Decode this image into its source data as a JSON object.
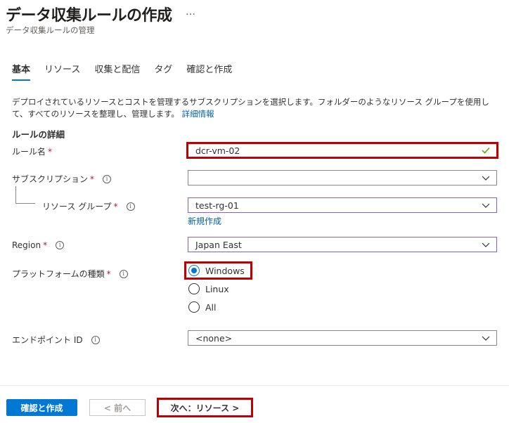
{
  "header": {
    "title": "データ収集ルールの作成",
    "more": "…",
    "subtitle": "データ収集ルールの管理"
  },
  "tabs": [
    {
      "label": "基本",
      "active": true
    },
    {
      "label": "リソース"
    },
    {
      "label": "収集と配信"
    },
    {
      "label": "タグ"
    },
    {
      "label": "確認と作成"
    }
  ],
  "description": {
    "text": "デプロイされているリソースとコストを管理するサブスクリプションを選択します。フォルダーのようなリソース グループを使用して、すべてのリソースを整理し、管理します。",
    "link": "詳細情報"
  },
  "section": {
    "title": "ルールの詳細"
  },
  "form": {
    "rule_name": {
      "label": "ルール名",
      "required": "*",
      "value": "dcr-vm-02"
    },
    "subscription": {
      "label": "サブスクリプション",
      "required": "*",
      "value": ""
    },
    "resource_group": {
      "label": "リソース グループ",
      "required": "*",
      "value": "test-rg-01",
      "new_link": "新規作成"
    },
    "region": {
      "label": "Region",
      "required": "*",
      "value": "Japan East"
    },
    "platform": {
      "label": "プラットフォームの種類",
      "required": "*",
      "options": [
        "Windows",
        "Linux",
        "All"
      ],
      "selected": "Windows"
    },
    "endpoint": {
      "label": "エンドポイント ID",
      "value": "<none>"
    }
  },
  "info_glyph": "i",
  "footer": {
    "review_create": "確認と作成",
    "previous": "< 前へ",
    "next": "次へ：リソース >"
  },
  "colors": {
    "accent": "#0078d4",
    "highlight": "#c00000",
    "link": "#0062ad",
    "focus_border": "#8661c5",
    "valid": "#57a300"
  }
}
